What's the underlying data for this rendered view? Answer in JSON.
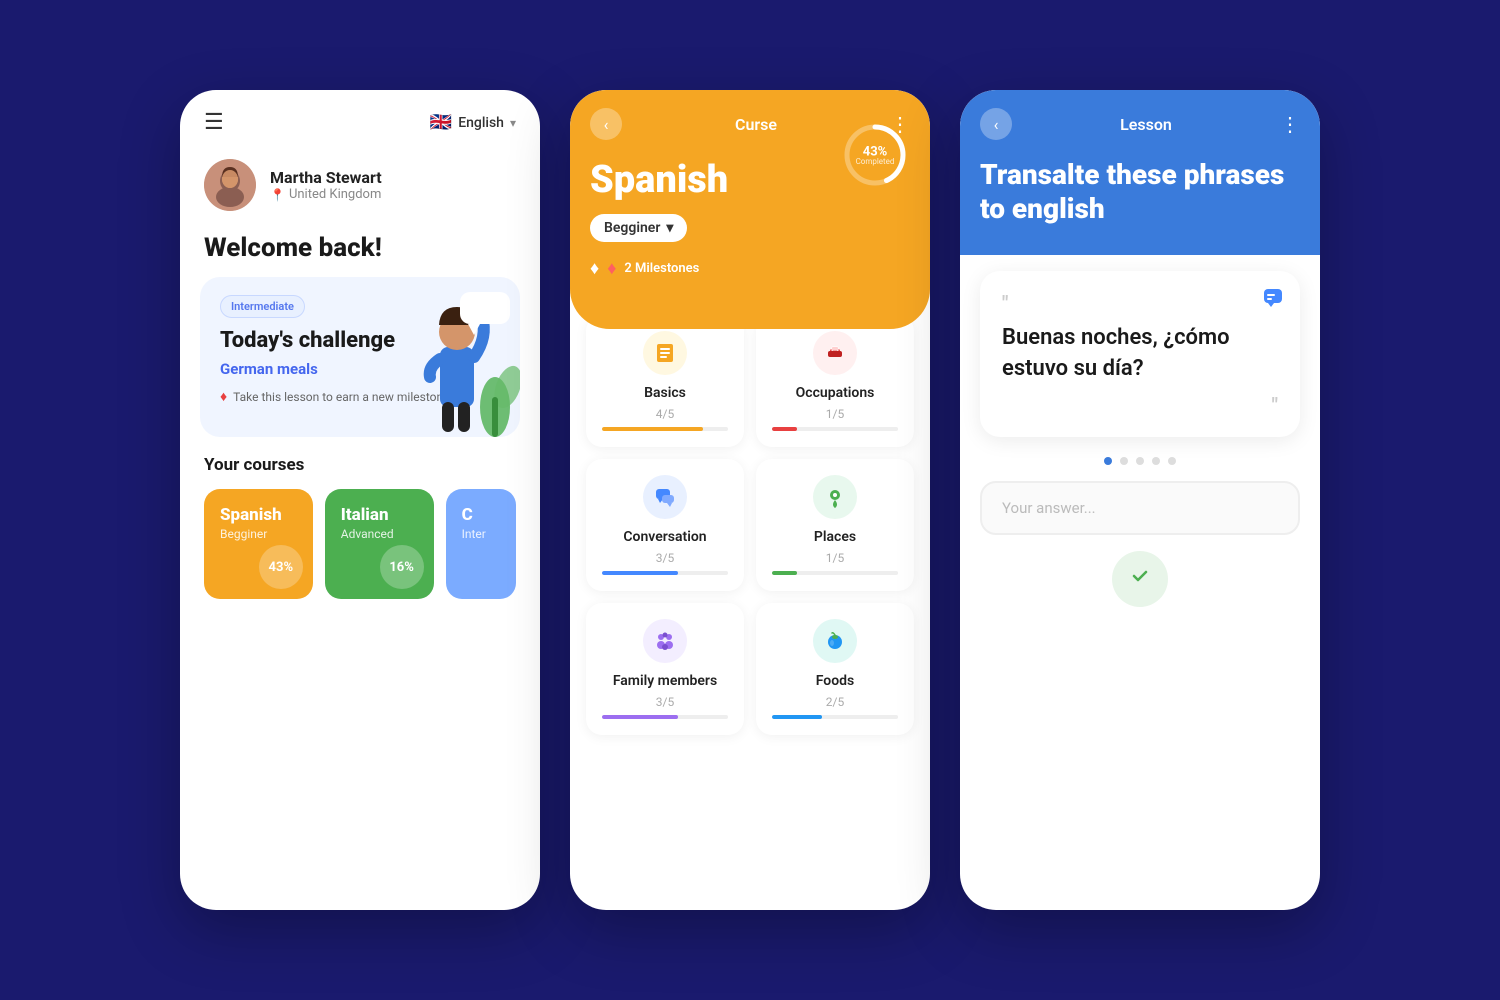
{
  "phone1": {
    "header": {
      "lang": "English",
      "chevron": "▾"
    },
    "profile": {
      "name": "Martha Stewart",
      "location": "United Kingdom"
    },
    "welcome": "Welcome back!",
    "challenge": {
      "badge": "Intermediate",
      "title": "Today's challenge",
      "subtitle": "German meals",
      "milestone_text": "Take this lesson to earn a new milestone"
    },
    "courses_title": "Your courses",
    "courses": [
      {
        "lang": "Spanish",
        "level": "Begginer",
        "pct": "43%"
      },
      {
        "lang": "Italian",
        "level": "Advanced",
        "pct": "16%"
      },
      {
        "lang": "C",
        "level": "Inter",
        "pct": ""
      }
    ]
  },
  "phone2": {
    "header": {
      "back": "‹",
      "title": "Curse",
      "dots": "⋮"
    },
    "course_name": "Spanish",
    "level": "Begginer",
    "level_chevron": "▾",
    "progress_pct": "43%",
    "progress_sub": "Completed",
    "milestones": "2 Milestones",
    "lessons": [
      {
        "name": "Basics",
        "count": "4/5",
        "icon": "📄",
        "icon_class": "yellow",
        "fill": "75",
        "color": "#f5a623"
      },
      {
        "name": "Occupations",
        "count": "1/5",
        "icon": "💼",
        "icon_class": "red",
        "fill": "20",
        "color": "#e84040"
      },
      {
        "name": "Conversation",
        "count": "3/5",
        "icon": "💬",
        "icon_class": "blue",
        "fill": "60",
        "color": "#4488ff"
      },
      {
        "name": "Places",
        "count": "1/5",
        "icon": "📍",
        "icon_class": "green",
        "fill": "20",
        "color": "#4caf50"
      },
      {
        "name": "Family members",
        "count": "3/5",
        "icon": "👨‍👩‍👧",
        "icon_class": "purple",
        "fill": "60",
        "color": "#9c6ef0"
      },
      {
        "name": "Foods",
        "count": "2/5",
        "icon": "🍎",
        "icon_class": "teal",
        "fill": "40",
        "color": "#2196f3"
      }
    ]
  },
  "phone3": {
    "header": {
      "back": "‹",
      "title": "Lesson",
      "dots": "⋮"
    },
    "question_title": "Transalte these phrases to english",
    "phrase": "Buenas noches, ¿cómo estuvo su día?",
    "answer_placeholder": "Your answer...",
    "dots": [
      true,
      false,
      false,
      false,
      false
    ],
    "submit_icon": "✓"
  },
  "bg_color": "#1a1a6e"
}
